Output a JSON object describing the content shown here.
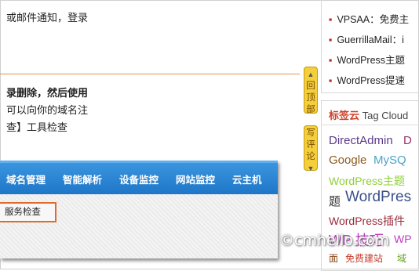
{
  "article": {
    "line1": "或邮件通知，登录",
    "para_bold": "录删除，然后使用",
    "para_line2": "可以向你的域名注",
    "para_line3": "查】工具检查"
  },
  "screenshot": {
    "nav_items": [
      "域名管理",
      "智能解析",
      "设备监控",
      "网站监控",
      "云主机"
    ],
    "service_button": "服务检查"
  },
  "side_tabs": {
    "back_to_top": [
      "回",
      "顶",
      "部"
    ],
    "comment": [
      "写",
      "评",
      "论"
    ]
  },
  "sidebar": {
    "recent_posts": [
      "VPSAA：免费主",
      "GuerrillaMail：i",
      "WordPress主题",
      "WordPress提速"
    ],
    "tag_cloud_title_cn": "标签云",
    "tag_cloud_title_en": "Tag Cloud",
    "tags": [
      {
        "text": "DirectAdmin",
        "color": "#5a3a8c"
      },
      {
        "text": "D",
        "color": "#a0306a"
      },
      {
        "text": "Google",
        "color": "#8b5a1a"
      },
      {
        "text": "MySQ",
        "color": "#4aa3c8"
      },
      {
        "text": "WordPress主题",
        "color": "#8fcf3a"
      },
      {
        "text": "题",
        "color": "#333333"
      },
      {
        "text": "WordPres",
        "color": "#3b4f8a"
      },
      {
        "text": "WordPress插件",
        "color": "#9a2c3c"
      },
      {
        "text": "WP 技巧",
        "color": "#c03ac0"
      },
      {
        "text": "WP",
        "color": "#c03ac0"
      },
      {
        "text": "面",
        "color": "#8a4a1a"
      },
      {
        "text": "免费建站",
        "color": "#c43a2a"
      },
      {
        "text": "域",
        "color": "#6aa82a"
      }
    ]
  },
  "watermark": "©cmhello.com"
}
